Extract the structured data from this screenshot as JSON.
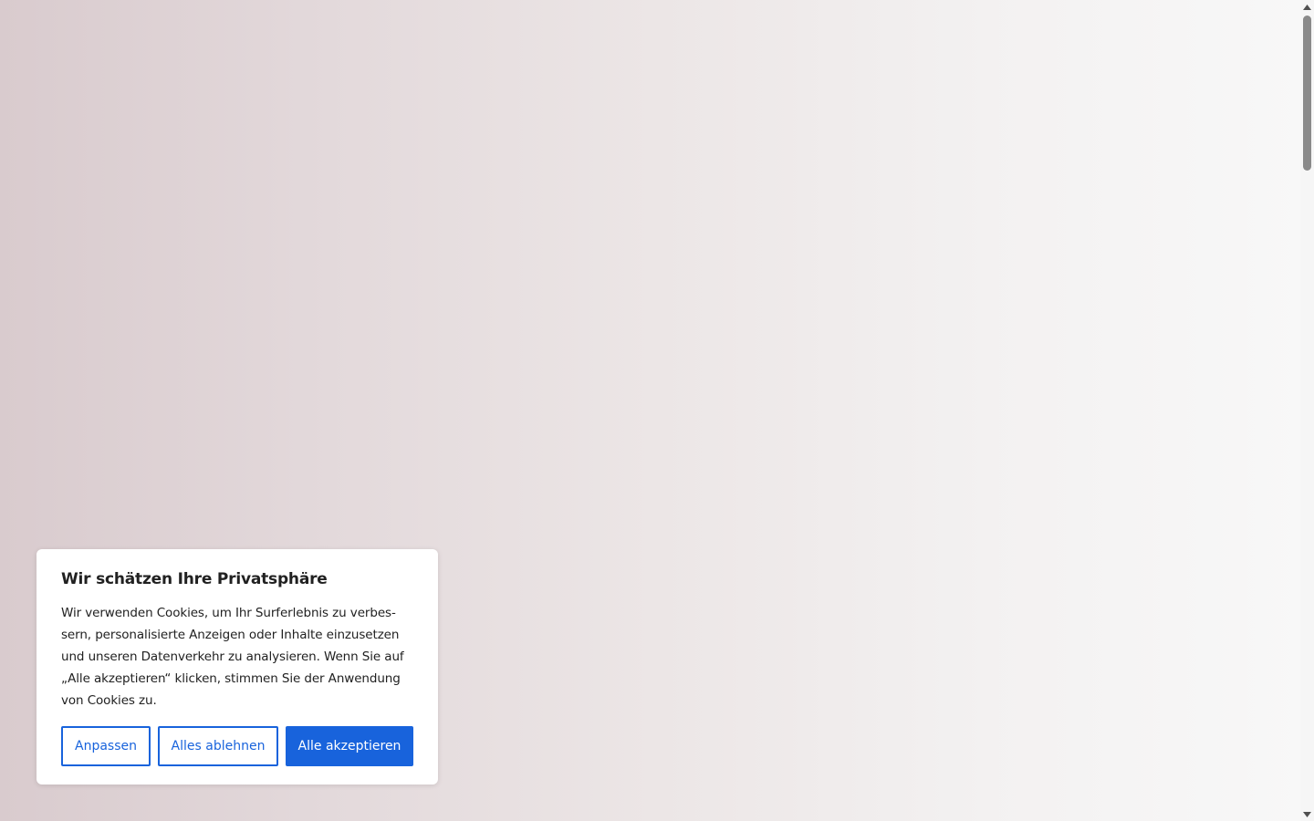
{
  "cookie_banner": {
    "title": "Wir schätzen Ihre Privatsphäre",
    "text": "Wir verwenden Cookies, um Ihr Surferlebnis zu verbes­sern, personalisierte Anzeigen oder Inhalte einzusetzen und unseren Datenverkehr zu analysieren. Wenn Sie auf „Alle akzeptieren“ klicken, stimmen Sie der Anwen­dung von Cookies zu.",
    "buttons": {
      "customize": "Anpassen",
      "reject": "Alles ablehnen",
      "accept": "Alle akzeptieren"
    }
  },
  "colors": {
    "accent": "#1863dc",
    "banner_bg": "#ffffff",
    "text": "#212121"
  },
  "icons": {
    "scroll_up": "scroll-up-arrow-icon",
    "scroll_down": "scroll-down-arrow-icon"
  }
}
